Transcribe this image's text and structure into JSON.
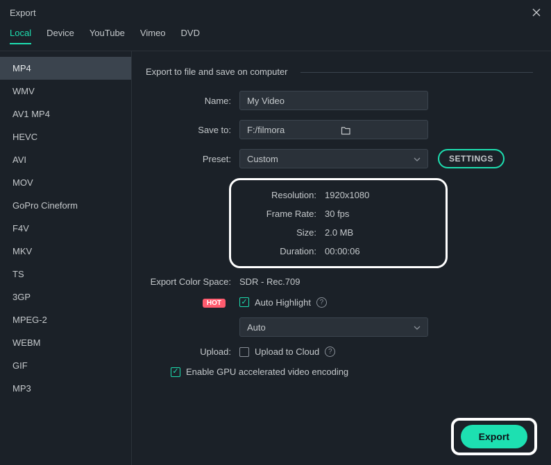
{
  "window": {
    "title": "Export"
  },
  "tabs": {
    "local": "Local",
    "device": "Device",
    "youtube": "YouTube",
    "vimeo": "Vimeo",
    "dvd": "DVD"
  },
  "formats": [
    "MP4",
    "WMV",
    "AV1 MP4",
    "HEVC",
    "AVI",
    "MOV",
    "GoPro Cineform",
    "F4V",
    "MKV",
    "TS",
    "3GP",
    "MPEG-2",
    "WEBM",
    "GIF",
    "MP3"
  ],
  "heading": "Export to file and save on computer",
  "labels": {
    "name": "Name:",
    "saveto": "Save to:",
    "preset": "Preset:",
    "resolution": "Resolution:",
    "framerate": "Frame Rate:",
    "size": "Size:",
    "duration": "Duration:",
    "colorspace": "Export Color Space:",
    "upload": "Upload:"
  },
  "values": {
    "name": "My Video",
    "saveto": "F:/filmora",
    "preset": "Custom",
    "resolution": "1920x1080",
    "framerate": "30 fps",
    "size": "2.0 MB",
    "duration": "00:00:06",
    "colorspace": "SDR - Rec.709",
    "autohighlight_label": "Auto Highlight",
    "autohighlight_mode": "Auto",
    "upload_label": "Upload to Cloud",
    "gpu_label": "Enable GPU accelerated video encoding"
  },
  "buttons": {
    "settings": "SETTINGS",
    "export": "Export"
  },
  "badges": {
    "hot": "HOT"
  }
}
